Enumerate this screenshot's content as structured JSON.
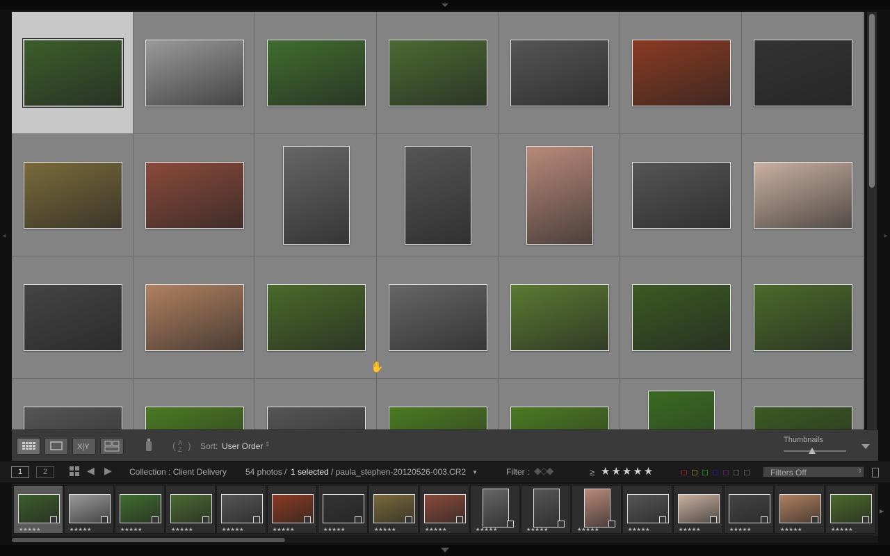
{
  "toolbar": {
    "view_modes": [
      "grid-view",
      "loupe-view",
      "compare-view",
      "survey-view"
    ],
    "sort_label": "Sort:",
    "sort_value": "User Order",
    "thumbnails_label": "Thumbnails",
    "thumbnail_size": 0.45
  },
  "filmbar": {
    "monitor_1": "1",
    "monitor_2": "2",
    "collection": "Collection : Client Delivery",
    "photo_count": "54 photos /",
    "selected": "1 selected",
    "filename": "/ paula_stephen-20120526-003.CR2",
    "filter_label": "Filter :",
    "rating_op": "≥",
    "rating_stars": "★★★★★",
    "filters_value": "Filters Off"
  },
  "colors": {
    "grid_bg": "#838383",
    "selected_cell": "#c8c8c8",
    "panel_bg": "#3a3a3a",
    "flag_colors": [
      "#7a2020",
      "#7a7a20",
      "#207a20",
      "#20207a",
      "#5a205a",
      "#555555",
      "#555555"
    ]
  },
  "grid": {
    "selected_index": 0,
    "thumbs": [
      {
        "o": "l",
        "c": "#3b5e2a"
      },
      {
        "o": "l",
        "c": "#9a9a9a"
      },
      {
        "o": "l",
        "c": "#3f6d2e"
      },
      {
        "o": "l",
        "c": "#4a6a32"
      },
      {
        "o": "l",
        "c": "#555"
      },
      {
        "o": "l",
        "c": "#8a3a22"
      },
      {
        "o": "l",
        "c": "#333"
      },
      {
        "o": "l",
        "c": "#7a6a3a"
      },
      {
        "o": "l",
        "c": "#8a4a3a"
      },
      {
        "o": "p",
        "c": "#666"
      },
      {
        "o": "p",
        "c": "#555"
      },
      {
        "o": "p",
        "c": "#b88a7a"
      },
      {
        "o": "l",
        "c": "#555"
      },
      {
        "o": "l",
        "c": "#cab0a0"
      },
      {
        "o": "l",
        "c": "#444"
      },
      {
        "o": "l",
        "c": "#b08060"
      },
      {
        "o": "l",
        "c": "#4a6a2a"
      },
      {
        "o": "l",
        "c": "#666"
      },
      {
        "o": "l",
        "c": "#5a7a32"
      },
      {
        "o": "l",
        "c": "#3a5a22"
      },
      {
        "o": "l",
        "c": "#4a6a2a"
      },
      {
        "o": "l",
        "c": "#555"
      },
      {
        "o": "l",
        "c": "#4a7a22"
      },
      {
        "o": "l",
        "c": "#555"
      },
      {
        "o": "l",
        "c": "#4a7a22"
      },
      {
        "o": "l",
        "c": "#4a7a22"
      },
      {
        "o": "p",
        "c": "#3a6a22"
      },
      {
        "o": "l",
        "c": "#3a5a22"
      }
    ]
  },
  "filmstrip": [
    {
      "c": "#3b5e2a",
      "o": "l",
      "stars": "★★★★★"
    },
    {
      "c": "#9a9a9a",
      "o": "l",
      "stars": "★★★★★"
    },
    {
      "c": "#3f6d2e",
      "o": "l",
      "stars": "★★★★★"
    },
    {
      "c": "#4a6a32",
      "o": "l",
      "stars": "★★★★★"
    },
    {
      "c": "#555",
      "o": "l",
      "stars": "★★★★★"
    },
    {
      "c": "#8a3a22",
      "o": "l",
      "stars": "★★★★★"
    },
    {
      "c": "#333",
      "o": "l",
      "stars": "★★★★★"
    },
    {
      "c": "#7a6a3a",
      "o": "l",
      "stars": "★★★★★"
    },
    {
      "c": "#8a4a3a",
      "o": "l",
      "stars": "★★★★★"
    },
    {
      "c": "#666",
      "o": "p",
      "stars": "★★★★★"
    },
    {
      "c": "#555",
      "o": "p",
      "stars": "★★★★★"
    },
    {
      "c": "#b88a7a",
      "o": "p",
      "stars": "★★★★★"
    },
    {
      "c": "#555",
      "o": "l",
      "stars": "★★★★★"
    },
    {
      "c": "#cab0a0",
      "o": "l",
      "stars": "★★★★★"
    },
    {
      "c": "#444",
      "o": "l",
      "stars": "★★★★★"
    },
    {
      "c": "#b08060",
      "o": "l",
      "stars": "★★★★★"
    },
    {
      "c": "#4a6a2a",
      "o": "l",
      "stars": "★★★★★"
    }
  ]
}
